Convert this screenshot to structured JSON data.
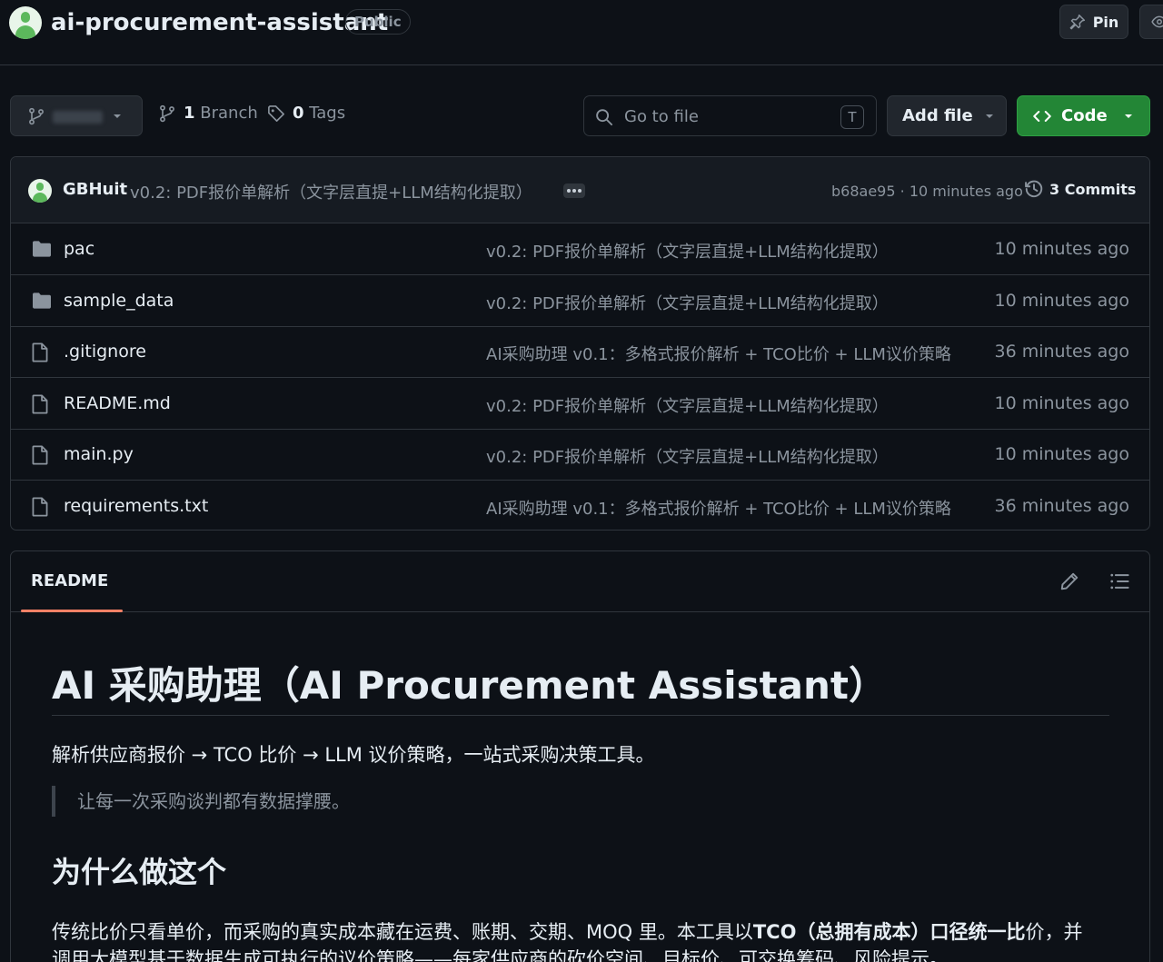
{
  "repo": {
    "name": "ai-procurement-assistant",
    "visibility": "Public",
    "pin_label": "Pin"
  },
  "toolbar": {
    "branch_count": "1",
    "branch_label": "Branch",
    "tag_count": "0",
    "tag_label": "Tags",
    "search_placeholder": "Go to file",
    "search_shortcut": "T",
    "add_file_label": "Add file",
    "code_label": "Code"
  },
  "latest_commit": {
    "author": "GBHuit",
    "message": "v0.2: PDF报价单解析（文字层直提+LLM结构化提取）",
    "hash": "b68ae95",
    "separator": "·",
    "time": "10 minutes ago",
    "commits_count": "3",
    "commits_label": "Commits"
  },
  "files": [
    {
      "name": "pac",
      "type": "folder",
      "message": "v0.2: PDF报价单解析（文字层直提+LLM结构化提取）",
      "age": "10 minutes ago"
    },
    {
      "name": "sample_data",
      "type": "folder",
      "message": "v0.2: PDF报价单解析（文字层直提+LLM结构化提取）",
      "age": "10 minutes ago"
    },
    {
      "name": ".gitignore",
      "type": "file",
      "message": "AI采购助理 v0.1：多格式报价解析 + TCO比价 + LLM议价策略",
      "age": "36 minutes ago"
    },
    {
      "name": "README.md",
      "type": "file",
      "message": "v0.2: PDF报价单解析（文字层直提+LLM结构化提取）",
      "age": "10 minutes ago"
    },
    {
      "name": "main.py",
      "type": "file",
      "message": "v0.2: PDF报价单解析（文字层直提+LLM结构化提取）",
      "age": "10 minutes ago"
    },
    {
      "name": "requirements.txt",
      "type": "file",
      "message": "AI采购助理 v0.1：多格式报价解析 + TCO比价 + LLM议价策略",
      "age": "36 minutes ago"
    }
  ],
  "readme": {
    "tab_label": "README",
    "h1": "AI 采购助理（AI Procurement Assistant）",
    "lead": "解析供应商报价 → TCO 比价 → LLM 议价策略，一站式采购决策工具。",
    "quote": "让每一次采购谈判都有数据撑腰。",
    "h2": "为什么做这个",
    "para_before": "传统比价只看单价，而采购的真实成本藏在运费、账期、交期、MOQ 里。本工具以",
    "para_bold": "TCO（总拥有成本）口径统一比",
    "para_after": "价，并调用大模型基于数据生成可执行的议价策略——每家供应商的砍价空间、目标价、可交换筹码、风险提示。"
  },
  "colors": {
    "background": "#0d1117",
    "border": "#30363d",
    "muted_text": "#8b949e",
    "code_button": "#238636",
    "tab_underline": "#f78166"
  }
}
